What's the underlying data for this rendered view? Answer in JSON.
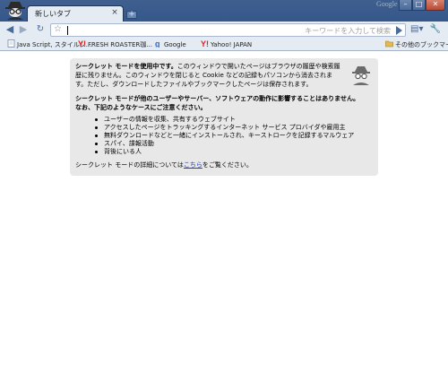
{
  "window": {
    "brand": "Google",
    "minimize_glyph": "–",
    "maximize_glyph": "□",
    "close_glyph": "✕"
  },
  "tab": {
    "title": "新しいタブ",
    "close_glyph": "×",
    "new_tab_glyph": "+"
  },
  "toolbar": {
    "back_glyph": "◀",
    "forward_glyph": "▶",
    "reload_glyph": "↻",
    "star_glyph": "☆",
    "omnibox_value": "",
    "omnibox_placeholder": "キーワードを入力して検索",
    "page_menu_glyph": "▤▾",
    "wrench_glyph": "🔧▾"
  },
  "bookmarks": {
    "items": [
      {
        "label": "Java Script, スタイルシ...",
        "icon": "page-icon"
      },
      {
        "label": "FRESH ROASTER珈...",
        "icon": "yahoo-icon"
      },
      {
        "label": "Google",
        "icon": "google-icon"
      },
      {
        "label": "Yahoo! JAPAN",
        "icon": "yahoo-icon"
      }
    ],
    "other_label": "その他のブックマーク",
    "colors": {
      "yahoo": "#e02020",
      "folder": "#e8b84a"
    }
  },
  "incognito": {
    "para1_bold": "シークレット モードを使用中です。",
    "para1_rest": "このウィンドウで開いたページはブラウザの履歴や検索履歴に残りません。このウィンドウを閉じると Cookie などの記録もパソコンから消去されます。ただし、ダウンロードしたファイルやブックマークしたページは保存されます。",
    "para2": "シークレット モードが他のユーザーやサーバー、ソフトウェアの動作に影響することはありません。なお、下記のようなケースにご注意ください。",
    "list": [
      "ユーザーの情報を収集、共有するウェブサイト",
      "アクセスしたページをトラッキングするインターネット サービス プロバイダや雇用主",
      "無料ダウンロードなどと一緒にインストールされ、キーストロークを記録するマルウェア",
      "スパイ、諜報活動",
      "背後にいる人"
    ],
    "learn_prefix": "シークレット モードの詳細については",
    "learn_link": "こちら",
    "learn_suffix": "をご覧ください。"
  }
}
